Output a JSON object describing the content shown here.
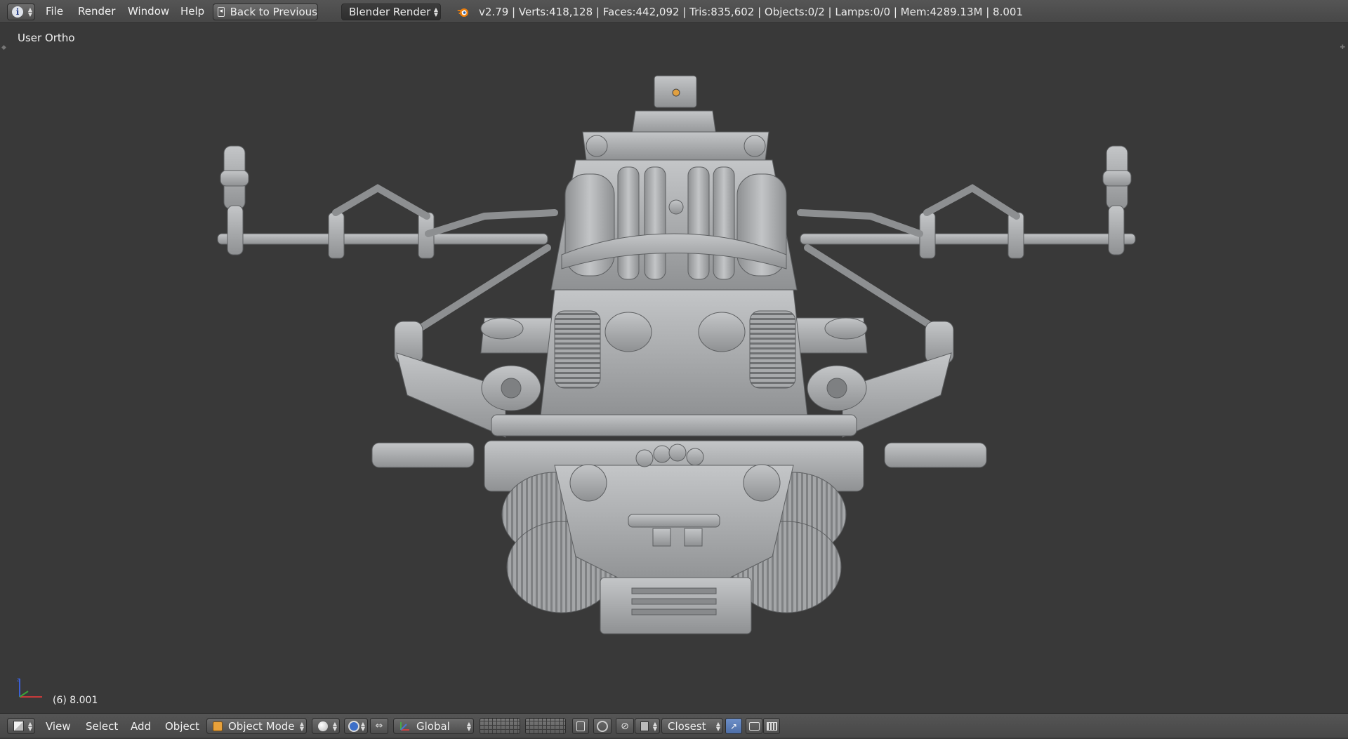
{
  "header": {
    "editor_icon": "info-icon",
    "menus": [
      "File",
      "Render",
      "Window",
      "Help"
    ],
    "back_button": "Back to Previous",
    "render_engine": "Blender Render",
    "stats": "v2.79 | Verts:418,128 | Faces:442,092 | Tris:835,602 | Objects:0/2 | Lamps:0/0 | Mem:4289.13M | 8.001"
  },
  "viewport": {
    "view_name": "User Ortho",
    "frame_info": "(6) 8.001",
    "background_color": "#393939",
    "model_color": "#a9abad"
  },
  "footer": {
    "editor_icon": "3d-view-cube-icon",
    "menus": [
      "View",
      "Select",
      "Add",
      "Object"
    ],
    "mode": "Object Mode",
    "viewport_shading": "solid-sphere-icon",
    "pivot_icon": "pivot-point-icon",
    "manipulator_icon": "manipulator-icon",
    "orientation": "Global",
    "snap_target": "Closest"
  }
}
